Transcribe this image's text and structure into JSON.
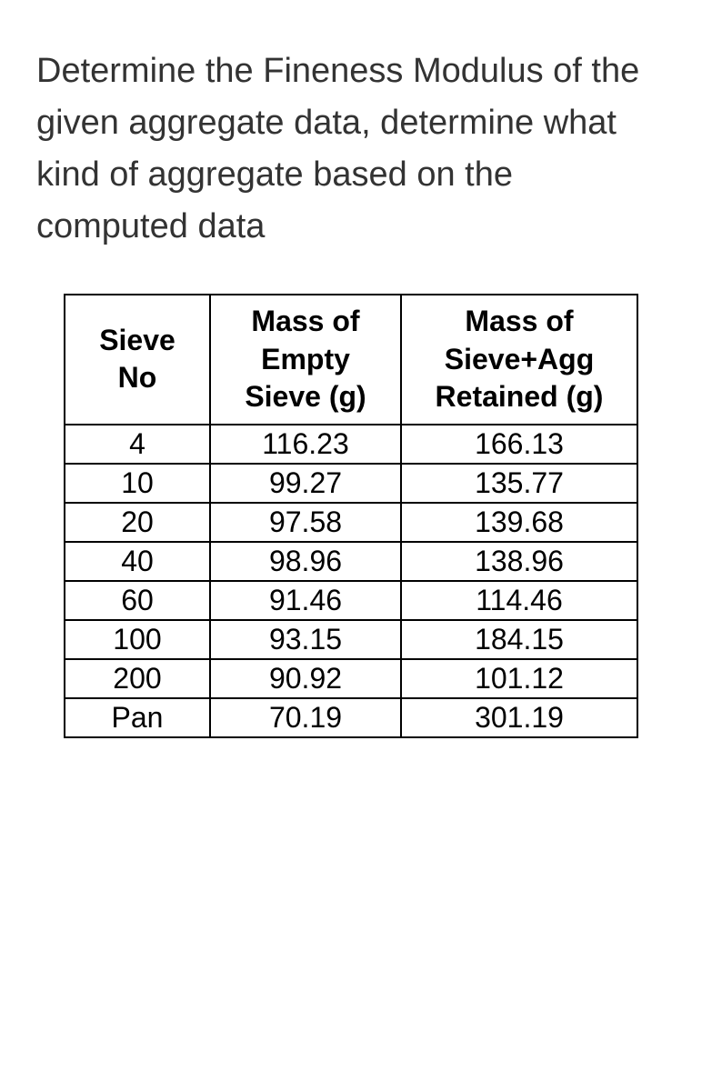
{
  "question": "Determine the Fineness Modulus of the given aggregate data, determine what kind of aggregate based on the computed data",
  "table": {
    "headers": {
      "col1": "Sieve No",
      "col2": "Mass of Empty Sieve (g)",
      "col3": "Mass of Sieve+Agg Retained (g)"
    },
    "rows": [
      {
        "sieve": "4",
        "empty": "116.23",
        "retained": "166.13"
      },
      {
        "sieve": "10",
        "empty": "99.27",
        "retained": "135.77"
      },
      {
        "sieve": "20",
        "empty": "97.58",
        "retained": "139.68"
      },
      {
        "sieve": "40",
        "empty": "98.96",
        "retained": "138.96"
      },
      {
        "sieve": "60",
        "empty": "91.46",
        "retained": "114.46"
      },
      {
        "sieve": "100",
        "empty": "93.15",
        "retained": "184.15"
      },
      {
        "sieve": "200",
        "empty": "90.92",
        "retained": "101.12"
      },
      {
        "sieve": "Pan",
        "empty": "70.19",
        "retained": "301.19"
      }
    ]
  }
}
